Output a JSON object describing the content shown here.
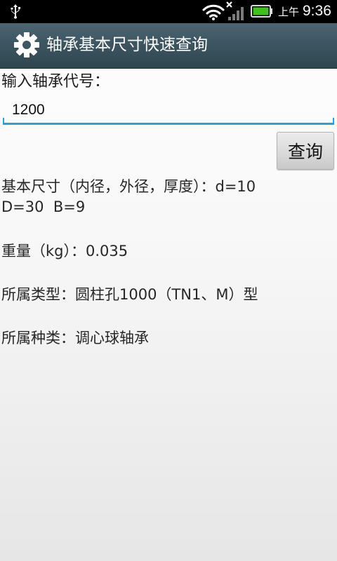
{
  "status_bar": {
    "ampm": "上午",
    "time": "9:36",
    "icons": [
      "usb-icon",
      "wifi-icon",
      "signal-icon",
      "battery-icon"
    ],
    "battery_color": "#3fc11c"
  },
  "title_bar": {
    "title": "轴承基本尺寸快速查询",
    "icon": "gear-icon"
  },
  "form": {
    "input_label": "输入轴承代号：",
    "code_value": "1200",
    "query_button": "查询",
    "accent_color": "#27a3dc"
  },
  "results": {
    "size_line1": "基本尺寸（内径，外径，厚度）：d=10",
    "size_line2": "D=30  B=9",
    "weight": "重量（kg）：0.035",
    "type": "所属类型：圆柱孔1000（TN1、M）型",
    "kind": "所属种类：调心球轴承"
  }
}
